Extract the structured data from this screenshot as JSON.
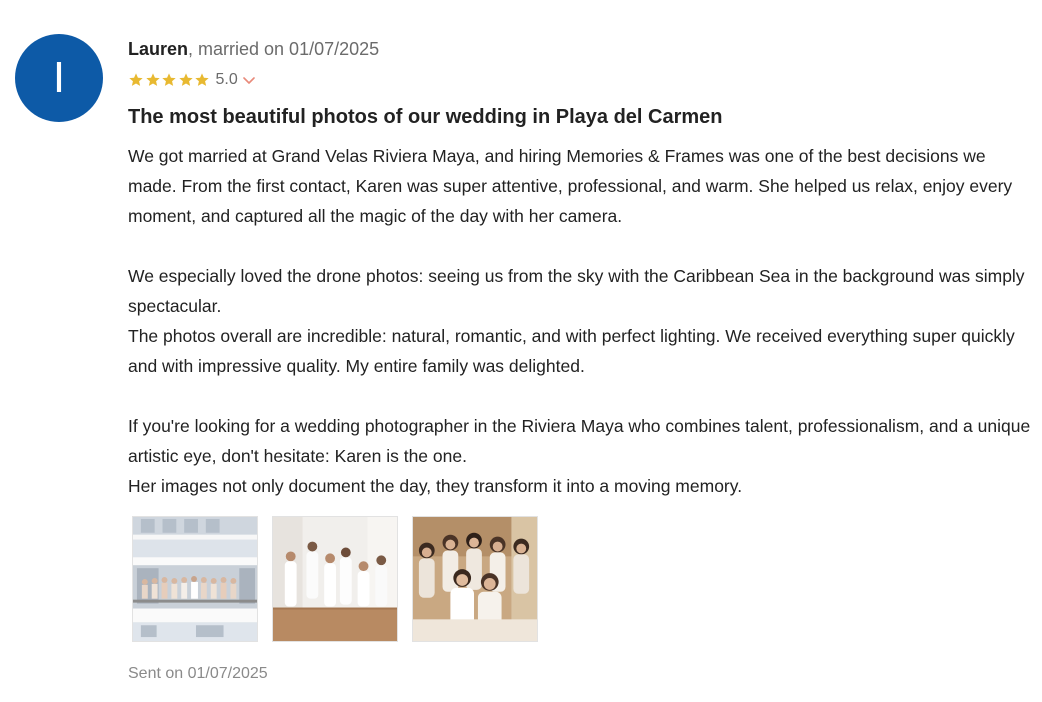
{
  "review": {
    "avatar_initial": "I",
    "author_name": "Lauren",
    "author_meta": ", married on 01/07/2025",
    "rating": "5.0",
    "stars_filled": 5,
    "star_color": "#e8b931",
    "accent_color": "#e88a7a",
    "avatar_color": "#0d5aa7",
    "title": "The most beautiful photos of our wedding in Playa del Carmen",
    "paragraphs": [
      "We got married at Grand Velas Riviera Maya, and hiring Memories & Frames was one of the best decisions we made. From the first contact, Karen was super attentive, professional, and warm. She helped us relax, enjoy every moment, and captured all the magic of the day with her camera.",
      "We especially loved the drone photos: seeing us from the sky with the Caribbean Sea in the background was simply spectacular.",
      "The photos overall are incredible: natural, romantic, and with perfect lighting. We received everything super quickly and with impressive quality. My entire family was delighted.",
      "If you're looking for a wedding photographer in the Riviera Maya who combines talent, professionalism, and a unique artistic eye, don't hesitate: Karen is the one.",
      "Her images not only document the day, they transform it into a moving memory."
    ],
    "photos": [
      {
        "icon": "photo-balcony-bridal-party"
      },
      {
        "icon": "photo-room-bridesmaids"
      },
      {
        "icon": "photo-bride-group-portrait"
      }
    ],
    "sent_label": "Sent on 01/07/2025"
  }
}
